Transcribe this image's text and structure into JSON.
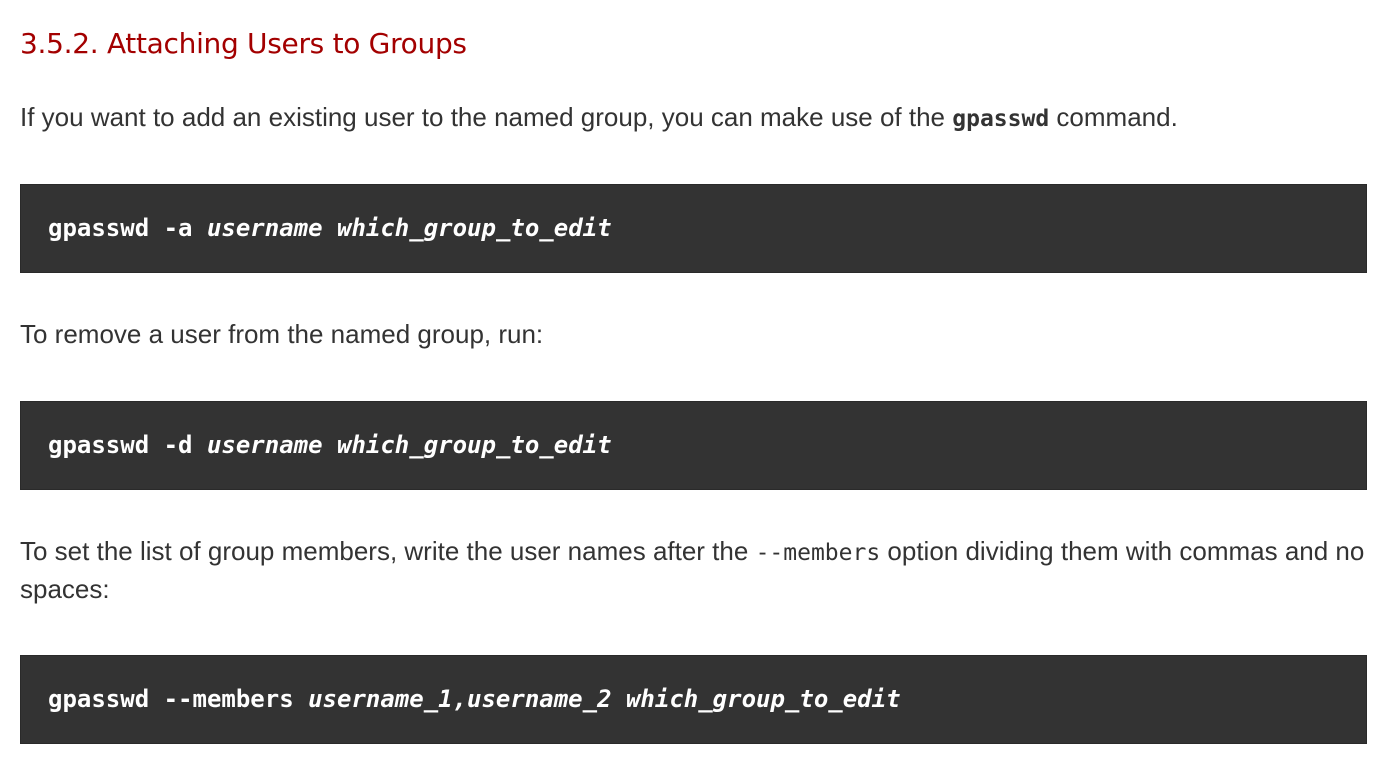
{
  "section": {
    "title": "3.5.2. Attaching Users to Groups"
  },
  "intro": {
    "text_before": "If you want to add an existing user to the named group, you can make use of the ",
    "command": "gpasswd",
    "text_after": " command."
  },
  "code_add": {
    "command": "gpasswd -a ",
    "arg_user": "username",
    "sep": " ",
    "arg_group": "which_group_to_edit"
  },
  "remove": {
    "text": "To remove a user from the named group, run:"
  },
  "code_remove": {
    "command": "gpasswd -d ",
    "arg_user": "username",
    "sep": " ",
    "arg_group": "which_group_to_edit"
  },
  "members": {
    "text_before": "To set the list of group members, write the user names after the ",
    "option": "--members",
    "text_after": " option dividing them with commas and no spaces:"
  },
  "code_members": {
    "command": "gpasswd --members ",
    "arg_users": "username_1,username_2",
    "sep": " ",
    "arg_group": "which_group_to_edit"
  }
}
